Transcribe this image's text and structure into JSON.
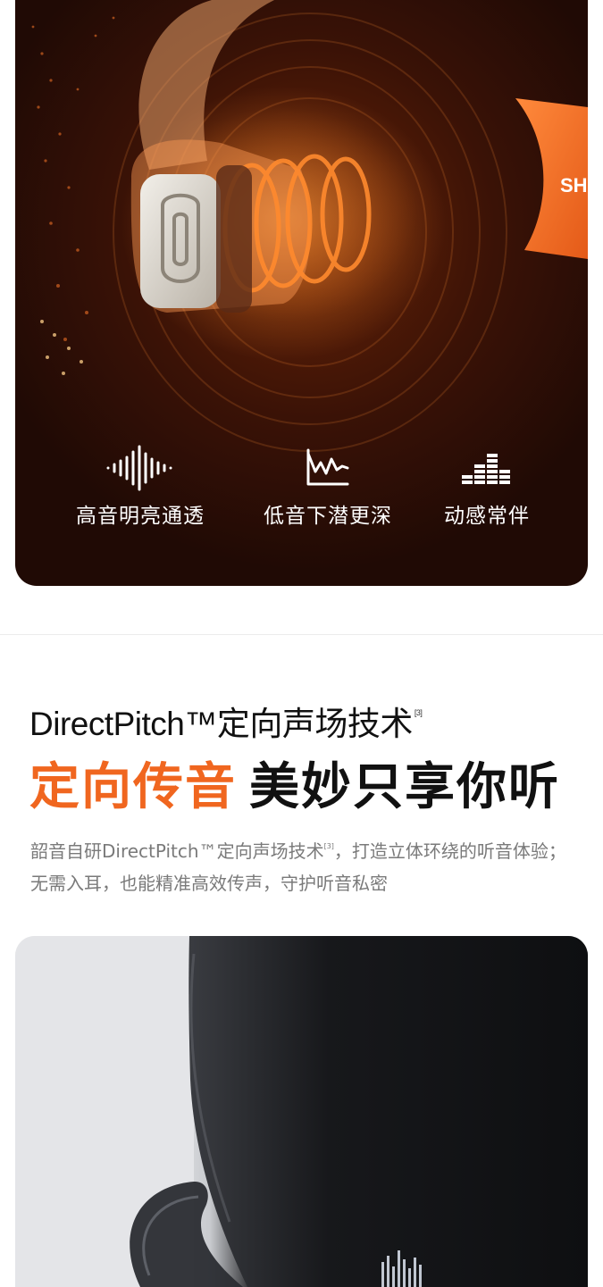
{
  "hero": {
    "brand_fragment": "SH",
    "features": [
      {
        "icon": "treble-waveform-icon",
        "label": "高音明亮通透"
      },
      {
        "icon": "bass-frequency-icon",
        "label": "低音下潜更深"
      },
      {
        "icon": "equalizer-bars-icon",
        "label": "动感常伴"
      }
    ],
    "accent_color": "#f0661f"
  },
  "section": {
    "tech_title": "DirectPitch™定向声场技术",
    "tech_title_note": "[3]",
    "headline_accent": "定向传音",
    "headline_dark": "美妙只享你听",
    "desc_part1": "韶音自研DirectPitch™定向声场技术",
    "desc_note": "[3]",
    "desc_part2": "，打造立体环绕的听音体验；无需入耳，也能精准高效传声，守护听音私密"
  }
}
